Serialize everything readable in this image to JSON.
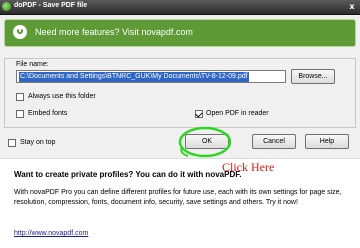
{
  "window": {
    "title": "doPDF - Save PDF file",
    "close_glyph": "x"
  },
  "banner": {
    "text": "Need more features? Visit novapdf.com",
    "icon": "novapdf-logo-icon"
  },
  "file": {
    "label": "File name:",
    "value": "C:\\Documents and Settings\\BTNRC_GUK\\My Documents\\TV-8-12-09.pdf",
    "browse_label": "Browse..."
  },
  "options": {
    "always_use_folder": {
      "label": "Always use this folder",
      "checked": false
    },
    "embed_fonts": {
      "label": "Embed fonts",
      "checked": false
    },
    "open_pdf": {
      "label": "Open PDF in reader",
      "checked": true
    }
  },
  "footer": {
    "stay_on_top": {
      "label": "Stay on top",
      "checked": false
    },
    "ok_label": "OK",
    "cancel_label": "Cancel",
    "help_label": "Help"
  },
  "annotation": {
    "text": "Click Here",
    "color": "#e0190e",
    "ring_color": "#2fd61f"
  },
  "promo": {
    "title": "Want to create private profiles? You can do it with novaPDF.",
    "body": "With novaPDF Pro you can define different profiles for future use, each with its own settings for page size, resolution, compression, fonts, document info, security, save settings and others. Try it now!",
    "link": "http://www.novapdf.com"
  },
  "colors": {
    "banner": "#5e9a35",
    "selection": "#3167c4",
    "link": "#1a1aa6"
  }
}
